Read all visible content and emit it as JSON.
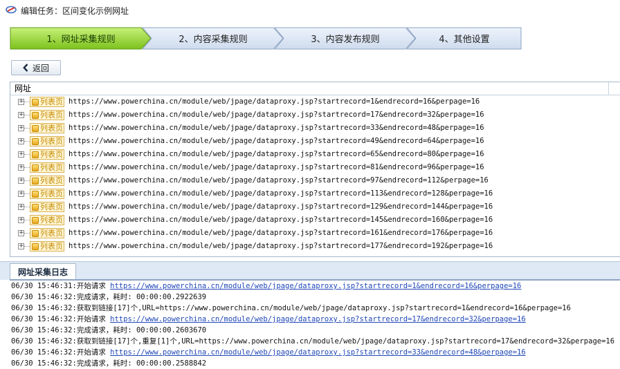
{
  "window": {
    "title": "编辑任务：区间变化示例网址"
  },
  "steps": [
    {
      "label": "1、网址采集规则",
      "active": true
    },
    {
      "label": "2、内容采集规则",
      "active": false
    },
    {
      "label": "3、内容发布规则",
      "active": false
    },
    {
      "label": "4、其他设置",
      "active": false
    }
  ],
  "back_button": {
    "label": "返回"
  },
  "tree": {
    "header": "网址",
    "rows": [
      {
        "tag": "列表页",
        "url": "https://www.powerchina.cn/module/web/jpage/dataproxy.jsp?startrecord=1&endrecord=16&perpage=16"
      },
      {
        "tag": "列表页",
        "url": "https://www.powerchina.cn/module/web/jpage/dataproxy.jsp?startrecord=17&endrecord=32&perpage=16"
      },
      {
        "tag": "列表页",
        "url": "https://www.powerchina.cn/module/web/jpage/dataproxy.jsp?startrecord=33&endrecord=48&perpage=16"
      },
      {
        "tag": "列表页",
        "url": "https://www.powerchina.cn/module/web/jpage/dataproxy.jsp?startrecord=49&endrecord=64&perpage=16"
      },
      {
        "tag": "列表页",
        "url": "https://www.powerchina.cn/module/web/jpage/dataproxy.jsp?startrecord=65&endrecord=80&perpage=16"
      },
      {
        "tag": "列表页",
        "url": "https://www.powerchina.cn/module/web/jpage/dataproxy.jsp?startrecord=81&endrecord=96&perpage=16"
      },
      {
        "tag": "列表页",
        "url": "https://www.powerchina.cn/module/web/jpage/dataproxy.jsp?startrecord=97&endrecord=112&perpage=16"
      },
      {
        "tag": "列表页",
        "url": "https://www.powerchina.cn/module/web/jpage/dataproxy.jsp?startrecord=113&endrecord=128&perpage=16"
      },
      {
        "tag": "列表页",
        "url": "https://www.powerchina.cn/module/web/jpage/dataproxy.jsp?startrecord=129&endrecord=144&perpage=16"
      },
      {
        "tag": "列表页",
        "url": "https://www.powerchina.cn/module/web/jpage/dataproxy.jsp?startrecord=145&endrecord=160&perpage=16"
      },
      {
        "tag": "列表页",
        "url": "https://www.powerchina.cn/module/web/jpage/dataproxy.jsp?startrecord=161&endrecord=176&perpage=16"
      },
      {
        "tag": "列表页",
        "url": "https://www.powerchina.cn/module/web/jpage/dataproxy.jsp?startrecord=177&endrecord=192&perpage=16"
      }
    ]
  },
  "log": {
    "tab_label": "网址采集日志",
    "lines": [
      {
        "prefix": "06/30 15:46:31:开始请求 ",
        "link": "https://www.powerchina.cn/module/web/jpage/dataproxy.jsp?startrecord=1&endrecord=16&perpage=16"
      },
      {
        "prefix": "06/30 15:46:32:完成请求，耗时: 00:00:00.2922639",
        "link": ""
      },
      {
        "prefix": "06/30 15:46:32:获取到链接[17]个,URL=https://www.powerchina.cn/module/web/jpage/dataproxy.jsp?startrecord=1&endrecord=16&perpage=16",
        "link": ""
      },
      {
        "prefix": "06/30 15:46:32:开始请求 ",
        "link": "https://www.powerchina.cn/module/web/jpage/dataproxy.jsp?startrecord=17&endrecord=32&perpage=16"
      },
      {
        "prefix": "06/30 15:46:32:完成请求，耗时: 00:00:00.2603670",
        "link": ""
      },
      {
        "prefix": "06/30 15:46:32:获取到链接[17]个,重复[1]个,URL=https://www.powerchina.cn/module/web/jpage/dataproxy.jsp?startrecord=17&endrecord=32&perpage=16",
        "link": ""
      },
      {
        "prefix": "06/30 15:46:32:开始请求 ",
        "link": "https://www.powerchina.cn/module/web/jpage/dataproxy.jsp?startrecord=33&endrecord=48&perpage=16"
      },
      {
        "prefix": "06/30 15:46:32:完成请求，耗时: 00:00:00.2588842",
        "link": ""
      }
    ]
  },
  "colors": {
    "active_step": "#9fd83a",
    "inactive_step": "#dbe5f3",
    "link": "#1f47b8"
  }
}
